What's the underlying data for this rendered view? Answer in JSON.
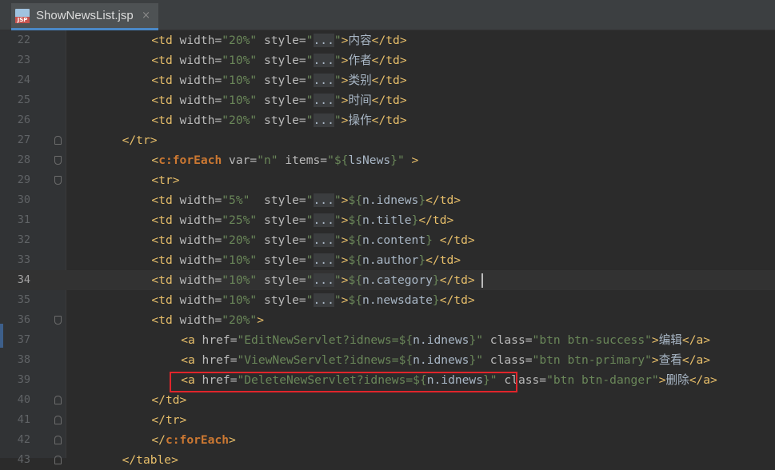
{
  "editor": {
    "tab": {
      "title": "ShowNewsList.jsp",
      "icon": "jsp-file-icon",
      "icon_label": "JSP",
      "close_glyph": "×"
    },
    "current_line": "34",
    "highlight_line": "39",
    "lines": [
      {
        "n": "22",
        "indent": 3,
        "t": [
          [
            "tg",
            "<td "
          ],
          [
            "at",
            "width="
          ],
          [
            "sv",
            "\"20%\""
          ],
          [
            "at",
            " style="
          ],
          [
            "sv",
            "\""
          ],
          [
            "fd",
            "..."
          ],
          [
            "sv",
            "\""
          ],
          [
            "tg",
            ">"
          ],
          [
            "pl",
            "内容"
          ],
          [
            "tg",
            "</td>"
          ]
        ]
      },
      {
        "n": "23",
        "indent": 3,
        "t": [
          [
            "tg",
            "<td "
          ],
          [
            "at",
            "width="
          ],
          [
            "sv",
            "\"10%\""
          ],
          [
            "at",
            " style="
          ],
          [
            "sv",
            "\""
          ],
          [
            "fd",
            "..."
          ],
          [
            "sv",
            "\""
          ],
          [
            "tg",
            ">"
          ],
          [
            "pl",
            "作者"
          ],
          [
            "tg",
            "</td>"
          ]
        ]
      },
      {
        "n": "24",
        "indent": 3,
        "t": [
          [
            "tg",
            "<td "
          ],
          [
            "at",
            "width="
          ],
          [
            "sv",
            "\"10%\""
          ],
          [
            "at",
            " style="
          ],
          [
            "sv",
            "\""
          ],
          [
            "fd",
            "..."
          ],
          [
            "sv",
            "\""
          ],
          [
            "tg",
            ">"
          ],
          [
            "pl",
            "类别"
          ],
          [
            "tg",
            "</td>"
          ]
        ]
      },
      {
        "n": "25",
        "indent": 3,
        "t": [
          [
            "tg",
            "<td "
          ],
          [
            "at",
            "width="
          ],
          [
            "sv",
            "\"10%\""
          ],
          [
            "at",
            " style="
          ],
          [
            "sv",
            "\""
          ],
          [
            "fd",
            "..."
          ],
          [
            "sv",
            "\""
          ],
          [
            "tg",
            ">"
          ],
          [
            "pl",
            "时间"
          ],
          [
            "tg",
            "</td>"
          ]
        ]
      },
      {
        "n": "26",
        "indent": 3,
        "t": [
          [
            "tg",
            "<td "
          ],
          [
            "at",
            "width="
          ],
          [
            "sv",
            "\"20%\""
          ],
          [
            "at",
            " style="
          ],
          [
            "sv",
            "\""
          ],
          [
            "fd",
            "..."
          ],
          [
            "sv",
            "\""
          ],
          [
            "tg",
            ">"
          ],
          [
            "pl",
            "操作"
          ],
          [
            "tg",
            "</td>"
          ]
        ]
      },
      {
        "n": "27",
        "indent": 2,
        "fold": "close",
        "t": [
          [
            "tg",
            "</tr>"
          ]
        ]
      },
      {
        "n": "28",
        "indent": 3,
        "fold": "open",
        "t": [
          [
            "tg",
            "<"
          ],
          [
            "el",
            "c:forEach"
          ],
          [
            "at",
            " var="
          ],
          [
            "sv",
            "\"n\""
          ],
          [
            "at",
            " items="
          ],
          [
            "sv",
            "\"${"
          ],
          [
            "pl",
            "lsNews"
          ],
          [
            "sv",
            "}\""
          ],
          [
            "tg",
            " >"
          ]
        ]
      },
      {
        "n": "29",
        "indent": 3,
        "fold": "open",
        "t": [
          [
            "tg",
            "<tr>"
          ]
        ]
      },
      {
        "n": "30",
        "indent": 3,
        "t": [
          [
            "tg",
            "<td "
          ],
          [
            "at",
            "width="
          ],
          [
            "sv",
            "\"5%\""
          ],
          [
            "at",
            "  style="
          ],
          [
            "sv",
            "\""
          ],
          [
            "fd",
            "..."
          ],
          [
            "sv",
            "\""
          ],
          [
            "tg",
            ">"
          ],
          [
            "sv",
            "${"
          ],
          [
            "pl",
            "n.idnews"
          ],
          [
            "sv",
            "}"
          ],
          [
            "tg",
            "</td>"
          ]
        ]
      },
      {
        "n": "31",
        "indent": 3,
        "t": [
          [
            "tg",
            "<td "
          ],
          [
            "at",
            "width="
          ],
          [
            "sv",
            "\"25%\""
          ],
          [
            "at",
            " style="
          ],
          [
            "sv",
            "\""
          ],
          [
            "fd",
            "..."
          ],
          [
            "sv",
            "\""
          ],
          [
            "tg",
            ">"
          ],
          [
            "sv",
            "${"
          ],
          [
            "pl",
            "n.title"
          ],
          [
            "sv",
            "}"
          ],
          [
            "tg",
            "</td>"
          ]
        ]
      },
      {
        "n": "32",
        "indent": 3,
        "t": [
          [
            "tg",
            "<td "
          ],
          [
            "at",
            "width="
          ],
          [
            "sv",
            "\"20%\""
          ],
          [
            "at",
            " style="
          ],
          [
            "sv",
            "\""
          ],
          [
            "fd",
            "..."
          ],
          [
            "sv",
            "\""
          ],
          [
            "tg",
            ">"
          ],
          [
            "sv",
            "${"
          ],
          [
            "pl",
            "n.content"
          ],
          [
            "sv",
            "}"
          ],
          [
            "pl",
            " "
          ],
          [
            "tg",
            "</td>"
          ]
        ]
      },
      {
        "n": "33",
        "indent": 3,
        "t": [
          [
            "tg",
            "<td "
          ],
          [
            "at",
            "width="
          ],
          [
            "sv",
            "\"10%\""
          ],
          [
            "at",
            " style="
          ],
          [
            "sv",
            "\""
          ],
          [
            "fd",
            "..."
          ],
          [
            "sv",
            "\""
          ],
          [
            "tg",
            ">"
          ],
          [
            "sv",
            "${"
          ],
          [
            "pl",
            "n.author"
          ],
          [
            "sv",
            "}"
          ],
          [
            "tg",
            "</td>"
          ]
        ]
      },
      {
        "n": "34",
        "indent": 3,
        "t": [
          [
            "tg",
            "<td "
          ],
          [
            "at",
            "width="
          ],
          [
            "sv",
            "\"10%\""
          ],
          [
            "at",
            " style="
          ],
          [
            "sv",
            "\""
          ],
          [
            "fd",
            "..."
          ],
          [
            "sv",
            "\""
          ],
          [
            "tg",
            ">"
          ],
          [
            "sv",
            "${"
          ],
          [
            "pl",
            "n.category"
          ],
          [
            "sv",
            "}"
          ],
          [
            "tg",
            "</td>"
          ]
        ]
      },
      {
        "n": "35",
        "indent": 3,
        "t": [
          [
            "tg",
            "<td "
          ],
          [
            "at",
            "width="
          ],
          [
            "sv",
            "\"10%\""
          ],
          [
            "at",
            " style="
          ],
          [
            "sv",
            "\""
          ],
          [
            "fd",
            "..."
          ],
          [
            "sv",
            "\""
          ],
          [
            "tg",
            ">"
          ],
          [
            "sv",
            "${"
          ],
          [
            "pl",
            "n.newsdate"
          ],
          [
            "sv",
            "}"
          ],
          [
            "tg",
            "</td>"
          ]
        ]
      },
      {
        "n": "36",
        "indent": 3,
        "fold": "open",
        "t": [
          [
            "tg",
            "<td "
          ],
          [
            "at",
            "width="
          ],
          [
            "sv",
            "\"20%\""
          ],
          [
            "tg",
            ">"
          ]
        ]
      },
      {
        "n": "37",
        "indent": 4,
        "t": [
          [
            "tg",
            "<a "
          ],
          [
            "at",
            "href="
          ],
          [
            "sv",
            "\"EditNewServlet?idnews=${"
          ],
          [
            "pl",
            "n.idnews"
          ],
          [
            "sv",
            "}\""
          ],
          [
            "at",
            " class="
          ],
          [
            "sv",
            "\"btn btn-success\""
          ],
          [
            "tg",
            ">"
          ],
          [
            "pl",
            "编辑"
          ],
          [
            "tg",
            "</a>"
          ]
        ]
      },
      {
        "n": "38",
        "indent": 4,
        "t": [
          [
            "tg",
            "<a "
          ],
          [
            "at",
            "href="
          ],
          [
            "sv",
            "\"ViewNewServlet?idnews=${"
          ],
          [
            "pl",
            "n.idnews"
          ],
          [
            "sv",
            "}\""
          ],
          [
            "at",
            " class="
          ],
          [
            "sv",
            "\"btn btn-primary\""
          ],
          [
            "tg",
            ">"
          ],
          [
            "pl",
            "查看"
          ],
          [
            "tg",
            "</a>"
          ]
        ]
      },
      {
        "n": "39",
        "indent": 4,
        "t": [
          [
            "tg",
            "<a "
          ],
          [
            "at",
            "href="
          ],
          [
            "sv",
            "\"DeleteNewServlet?idnews=${"
          ],
          [
            "pl",
            "n.idnews"
          ],
          [
            "sv",
            "}\""
          ],
          [
            "at",
            " class="
          ],
          [
            "sv",
            "\"btn btn-danger\""
          ],
          [
            "tg",
            ">"
          ],
          [
            "pl",
            "删除"
          ],
          [
            "tg",
            "</a>"
          ]
        ]
      },
      {
        "n": "40",
        "indent": 3,
        "fold": "close",
        "t": [
          [
            "tg",
            "</td>"
          ]
        ]
      },
      {
        "n": "41",
        "indent": 3,
        "fold": "close",
        "t": [
          [
            "tg",
            "</tr>"
          ]
        ]
      },
      {
        "n": "42",
        "indent": 3,
        "fold": "close",
        "t": [
          [
            "tg",
            "</"
          ],
          [
            "el",
            "c:forEach"
          ],
          [
            "tg",
            ">"
          ]
        ]
      },
      {
        "n": "43",
        "indent": 2,
        "fold": "close",
        "t": [
          [
            "tg",
            "</table>"
          ]
        ]
      }
    ]
  }
}
